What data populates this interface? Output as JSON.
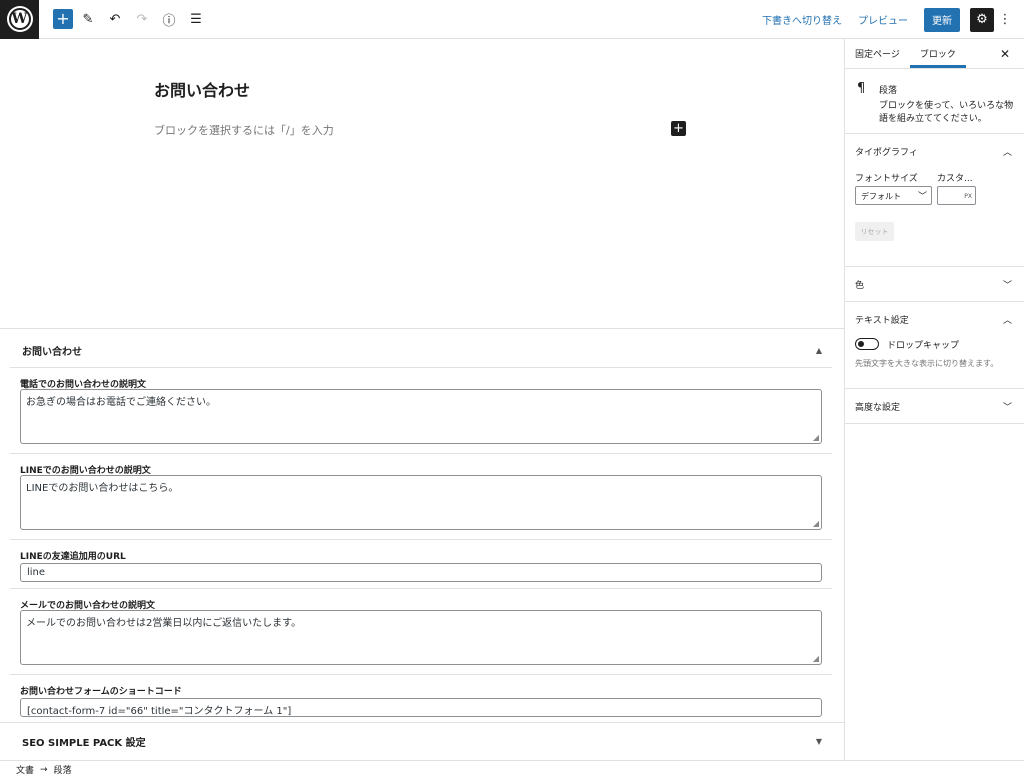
{
  "toolbar": {
    "draft_link": "下書きへ切り替え",
    "preview_link": "プレビュー",
    "update_button": "更新"
  },
  "editor": {
    "title": "お問い合わせ",
    "placeholder": "ブロックを選択するには「/」を入力"
  },
  "metabox": {
    "title": "お問い合わせ",
    "fields": [
      {
        "label": "電話でのお問い合わせの説明文",
        "value": "お急ぎの場合はお電話でご連絡ください。"
      },
      {
        "label": "LINEでのお問い合わせの説明文",
        "value": "LINEでのお問い合わせはこちら。"
      },
      {
        "label": "LINEの友達追加用のURL",
        "value": "line"
      },
      {
        "label": "メールでのお問い合わせの説明文",
        "value": "メールでのお問い合わせは2営業日以内にご返信いたします。"
      },
      {
        "label": "お問い合わせフォームのショートコード",
        "value": "[contact-form-7 id=\"66\" title=\"コンタクトフォーム 1\"]"
      }
    ],
    "seo_title": "SEO SIMPLE PACK 設定"
  },
  "footer": {
    "crumb1": "文書",
    "crumb2": "段落"
  },
  "sidebar": {
    "tab_page": "固定ページ",
    "tab_block": "ブロック",
    "block_name": "段落",
    "block_desc": "ブロックを使って、いろいろな物語を組み立ててください。",
    "typography_title": "タイポグラフィ",
    "font_size_label": "フォントサイズ",
    "custom_label": "カスタ...",
    "font_size_value": "デフォルト",
    "unit": "PX",
    "reset_label": "リセット",
    "color_title": "色",
    "text_settings_title": "テキスト設定",
    "drop_cap_label": "ドロップキャップ",
    "drop_cap_help": "先頭文字を大きな表示に切り替えます。",
    "advanced_title": "高度な設定"
  },
  "colors": {
    "accent": "#2271b1",
    "dark": "#1e1e1e",
    "border": "#e0e0e0"
  }
}
